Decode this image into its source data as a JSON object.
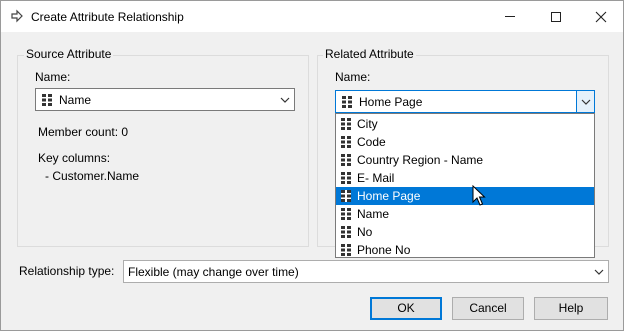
{
  "window": {
    "title": "Create Attribute Relationship",
    "minimize_glyph": "—",
    "close_glyph": "✕"
  },
  "source": {
    "group_title": "Source Attribute",
    "name_label": "Name:",
    "name_value": "Name",
    "member_count": "Member count: 0",
    "key_columns_label": "Key columns:",
    "key_column_1": "- Customer.Name"
  },
  "related": {
    "group_title": "Related Attribute",
    "name_label": "Name:",
    "name_value": "Home Page",
    "options": [
      "City",
      "Code",
      "Country Region - Name",
      "E- Mail",
      "Home Page",
      "Name",
      "No",
      "Phone No"
    ],
    "selected_option": "Home Page"
  },
  "relationship": {
    "label": "Relationship type:",
    "value": "Flexible (may change over time)"
  },
  "buttons": {
    "ok": "OK",
    "cancel": "Cancel",
    "help": "Help"
  },
  "colors": {
    "accent": "#0078d7",
    "window_bg": "#f0f0f0",
    "selection_text": "#ffffff"
  },
  "icons": {
    "title": "arrow-right-icon",
    "attribute": "attribute-grid-icon",
    "dropdown_arrow": "chevron-down-icon",
    "cursor": "mouse-pointer-icon"
  }
}
